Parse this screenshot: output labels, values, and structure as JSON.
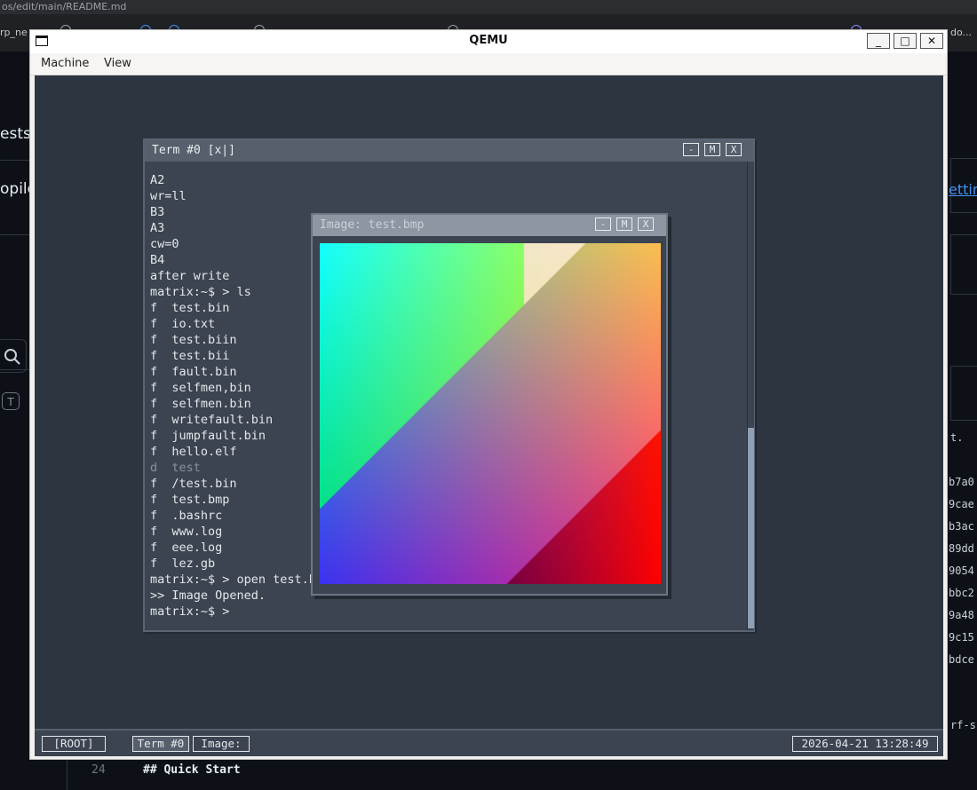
{
  "host": {
    "url_fragment": "os/edit/main/README.md",
    "tab_fragments": [
      "rp_ne",
      "do..."
    ],
    "left_fragments": [
      "ests",
      "opilo"
    ],
    "shortcut_key": "T",
    "right_setting": "etting",
    "right_dot": "t.",
    "hashes": [
      "b7a0",
      "9cae",
      "b3ac",
      "89dd",
      "9054",
      "bbc2",
      "9a48",
      "9c15",
      "bdce"
    ],
    "right_rfs": "rf-s",
    "editor_line_number": "24",
    "editor_line_text": "## Quick Start"
  },
  "qemu": {
    "title": "QEMU",
    "menu": [
      "Machine",
      "View"
    ],
    "controls": {
      "minimize": "_",
      "maximize": "□",
      "close": "✕"
    }
  },
  "guest": {
    "terminal": {
      "title": "Term #0 [x|]",
      "buttons": [
        "-",
        "M",
        "X"
      ],
      "lines": [
        "A2",
        "wr=ll",
        "B3",
        "A3",
        "cw=0",
        "B4",
        "after write",
        "matrix:~$ > ls",
        "f  test.bin",
        "f  io.txt",
        "f  test.biin",
        "f  test.bii",
        "f  fault.bin",
        "f  selfmen,bin",
        "f  selfmen.bin",
        "f  writefault.bin",
        "f  jumpfault.bin",
        "f  hello.elf",
        "d  test",
        "f  /test.bin",
        "f  test.bmp",
        "f  .bashrc",
        "f  www.log",
        "f  eee.log",
        "f  lez.gb",
        "matrix:~$ > open test.bmp",
        ">> Image Opened.",
        "matrix:~$ >"
      ],
      "dim_line_index": 18
    },
    "image_viewer": {
      "title": "Image: test.bmp",
      "buttons": [
        "-",
        "M",
        "X"
      ]
    },
    "taskbar": {
      "root": "[ROOT]",
      "items": [
        "Term #0",
        "Image:"
      ],
      "clock": "2026-04-21  13:28:49"
    }
  },
  "colors": {
    "guest_bg": "#2d3540",
    "window_bg": "#3b4450",
    "titlebar": "#56606c",
    "scroll_thumb": "#8fa0b4"
  }
}
